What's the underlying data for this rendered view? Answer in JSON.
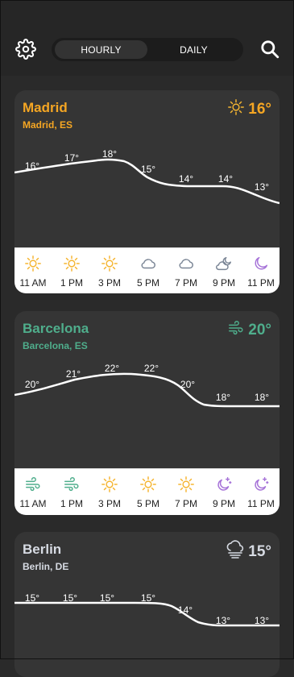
{
  "header": {
    "settings_icon": "gear-icon",
    "search_icon": "search-icon",
    "tabs": [
      {
        "label": "HOURLY",
        "active": true
      },
      {
        "label": "DAILY",
        "active": false
      }
    ]
  },
  "cards": [
    {
      "city": "Madrid",
      "subtitle": "Madrid, ES",
      "current_temp": "16°",
      "current_icon": "sun-icon",
      "accent": "#f5a623",
      "curve": [
        {
          "temp": "16°"
        },
        {
          "temp": "17°"
        },
        {
          "temp": "18°"
        },
        {
          "temp": "15°"
        },
        {
          "temp": "14°"
        },
        {
          "temp": "14°"
        },
        {
          "temp": "13°"
        }
      ],
      "hours": [
        {
          "time": "11 AM",
          "icon": "sun-icon"
        },
        {
          "time": "1 PM",
          "icon": "sun-icon"
        },
        {
          "time": "3 PM",
          "icon": "sun-icon"
        },
        {
          "time": "5 PM",
          "icon": "cloud-icon"
        },
        {
          "time": "7 PM",
          "icon": "cloud-icon"
        },
        {
          "time": "9 PM",
          "icon": "cloud-moon-icon"
        },
        {
          "time": "11 PM",
          "icon": "moon-icon"
        }
      ]
    },
    {
      "city": "Barcelona",
      "subtitle": "Barcelona, ES",
      "current_temp": "20°",
      "current_icon": "wind-icon",
      "accent": "#4fae8c",
      "curve": [
        {
          "temp": "20°"
        },
        {
          "temp": "21°"
        },
        {
          "temp": "22°"
        },
        {
          "temp": "22°"
        },
        {
          "temp": "20°"
        },
        {
          "temp": "18°"
        },
        {
          "temp": "18°"
        }
      ],
      "hours": [
        {
          "time": "11 AM",
          "icon": "wind-icon"
        },
        {
          "time": "1 PM",
          "icon": "wind-icon"
        },
        {
          "time": "3 PM",
          "icon": "sun-icon"
        },
        {
          "time": "5 PM",
          "icon": "sun-icon"
        },
        {
          "time": "7 PM",
          "icon": "sun-icon"
        },
        {
          "time": "9 PM",
          "icon": "moon-stars-icon"
        },
        {
          "time": "11 PM",
          "icon": "moon-stars-icon"
        }
      ]
    },
    {
      "city": "Berlin",
      "subtitle": "Berlin, DE",
      "current_temp": "15°",
      "current_icon": "fog-icon",
      "accent": "#d7dbe3",
      "curve": [
        {
          "temp": "15°"
        },
        {
          "temp": "15°"
        },
        {
          "temp": "15°"
        },
        {
          "temp": "15°"
        },
        {
          "temp": "14°"
        },
        {
          "temp": "13°"
        },
        {
          "temp": "13°"
        }
      ],
      "hours": []
    }
  ],
  "colors": {
    "background": "#2a2a2a",
    "card": "#353535",
    "sun": "#f5b531",
    "cloud": "#7a8595",
    "moon": "#a673d8",
    "wind": "#4fae8c"
  }
}
